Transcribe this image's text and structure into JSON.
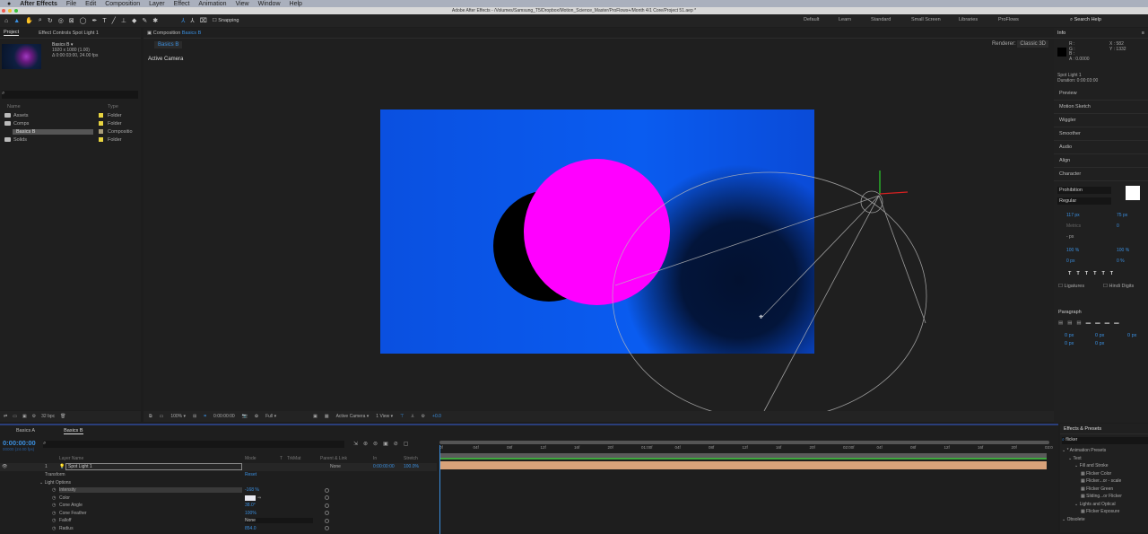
{
  "menubar": {
    "app": "After Effects",
    "items": [
      "File",
      "Edit",
      "Composition",
      "Layer",
      "Effect",
      "Animation",
      "View",
      "Window",
      "Help"
    ]
  },
  "window_title": "Adobe After Effects - /Volumes/Samsung_T5/Dropbox/Motion_Science_Master/ProFlows+/Month 4/1 Core/Project 51.aep *",
  "toolbar": {
    "snapping": "Snapping",
    "workspaces": [
      "Default",
      "Learn",
      "Standard",
      "Small Screen",
      "Libraries",
      "ProFlows"
    ],
    "search_help": "Search Help"
  },
  "project": {
    "tab": "Project",
    "effect_controls_tab": "Effect Controls Spot Light 1",
    "comp_name": "Basics B ▾",
    "comp_size": "1920 x 1080 (1.00)",
    "comp_duration": "Δ 0:00:03:00, 24.00 fps",
    "col_name": "Name",
    "col_type": "Type",
    "items": [
      {
        "name": "Assets",
        "type": "Folder"
      },
      {
        "name": "Comps",
        "type": "Folder"
      },
      {
        "name": "Basics B",
        "type": "Compositio"
      },
      {
        "name": "Solids",
        "type": "Folder"
      }
    ],
    "bpc": "32 bpc"
  },
  "viewer": {
    "tab_prefix": "Composition",
    "tab_name": "Basics B",
    "breadcrumb": "Basics B",
    "camera_label": "Active Camera",
    "renderer_label": "Renderer:",
    "renderer": "Classic 3D"
  },
  "viewer_toolbar": {
    "zoom": "100%",
    "timecode": "0:00:00:00",
    "resolution": "Full",
    "view": "Active Camera",
    "layout": "1 View",
    "exposure": "+0.0"
  },
  "info": {
    "title": "Info",
    "r": "R :",
    "g": "G :",
    "b": "B :",
    "a": "A :  0.0000",
    "x": "X : 582",
    "y": "Y : 1332",
    "layer": "Spot Light 1",
    "duration": "Duration: 0:00:03:00"
  },
  "right_sections": [
    "Preview",
    "Motion Sketch",
    "Wiggler",
    "Smoother",
    "Audio",
    "Align"
  ],
  "character": {
    "title": "Character",
    "font": "Prohibition",
    "style": "Regular",
    "size": "117 px",
    "leading": "75 px",
    "kerning": "Metrics",
    "tracking": "0",
    "stroke": "- px",
    "vscale": "100 %",
    "hscale": "100 %",
    "baseline": "0 px",
    "tsume": "0 %",
    "ligatures": "Ligatures",
    "hindi": "Hindi Digits"
  },
  "paragraph": {
    "title": "Paragraph",
    "indent": "0 px"
  },
  "timeline": {
    "tabs": [
      "Basics A",
      "Basics B"
    ],
    "timecode": "0:00:00:00",
    "fps": "00000 (24.00 fps)",
    "cols": {
      "layer_name": "Layer Name",
      "mode": "Mode",
      "t": "T",
      "trkmat": "TrkMat",
      "parent": "Parent & Link",
      "in": "In",
      "stretch": "Stretch"
    },
    "layer": {
      "num": "1",
      "name": "Spot Light 1",
      "parent": "None",
      "in": "0:00:00:00",
      "stretch": "100.0%"
    },
    "transform": "Transform",
    "reset": "Reset",
    "light_options": "Light Options",
    "props": [
      {
        "name": "Intensity",
        "value": "-168 %"
      },
      {
        "name": "Color",
        "value": ""
      },
      {
        "name": "Cone Angle",
        "value": "38.0°"
      },
      {
        "name": "Cone Feather",
        "value": "100%"
      },
      {
        "name": "Falloff",
        "value": "None"
      },
      {
        "name": "Radius",
        "value": "854.0"
      }
    ],
    "ruler": [
      "0f",
      "04f",
      "08f",
      "12f",
      "16f",
      "20f",
      "01:00f",
      "04f",
      "08f",
      "12f",
      "16f",
      "20f",
      "02:00f",
      "04f",
      "08f",
      "12f",
      "16f",
      "20f",
      "03:0"
    ]
  },
  "effects": {
    "title": "Effects & Presets",
    "search": "flicker",
    "tree": [
      {
        "label": "* Animation Presets",
        "lvl": 0
      },
      {
        "label": "Text",
        "lvl": 1
      },
      {
        "label": "Fill and Stroke",
        "lvl": 2
      },
      {
        "label": "Flicker Color",
        "lvl": 3
      },
      {
        "label": "Flicker...or - scale",
        "lvl": 3
      },
      {
        "label": "Flicker Green",
        "lvl": 3
      },
      {
        "label": "Sliding...or Flicker",
        "lvl": 3
      },
      {
        "label": "Lights and Optical",
        "lvl": 2
      },
      {
        "label": "Flicker Exposure",
        "lvl": 3
      },
      {
        "label": "Obsolete",
        "lvl": 0
      }
    ]
  },
  "colors": {
    "accent": "#3a8fe0",
    "comp_bg": "#0a5cf0",
    "circle": "#ff00ff",
    "layer_bar": "#d9a27a",
    "work_area": "#3ea83e"
  }
}
